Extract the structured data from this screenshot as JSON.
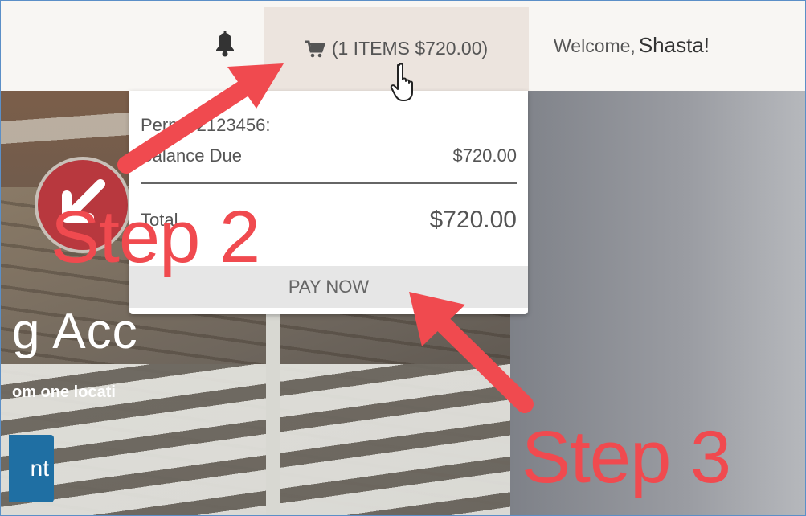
{
  "navbar": {
    "cart_label": "(1 ITEMS $720.00)",
    "welcome_prefix": "Welcome,",
    "welcome_name": "Shasta!"
  },
  "hero": {
    "title": "g Acc",
    "subtitle": "om one locati",
    "button_label": "nt"
  },
  "dropdown": {
    "permit_label": "Permit 2123456:",
    "balance_label": "Balance Due",
    "balance_amount": "$720.00",
    "total_label": "Total",
    "total_amount": "$720.00",
    "pay_button": "PAY NOW"
  },
  "annotations": {
    "step2": "Step 2",
    "step3": "Step 3",
    "color": "#f04a4f"
  },
  "icons": [
    "bell-icon",
    "cart-icon",
    "hand-cursor-icon",
    "down-left-arrow-icon"
  ]
}
